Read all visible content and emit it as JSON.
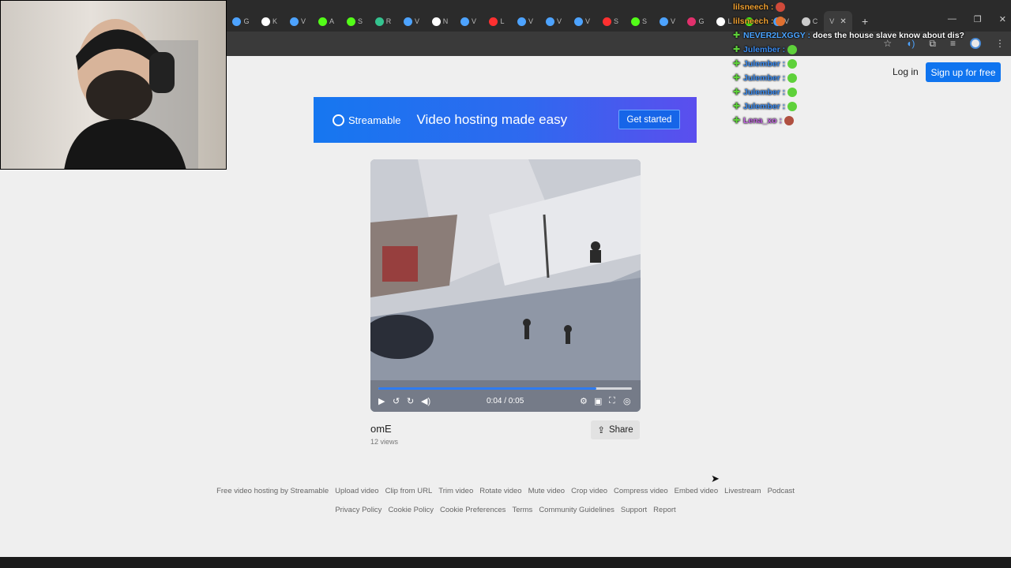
{
  "browser": {
    "tabs": [
      {
        "icon": "streamable-icon",
        "letter": "G",
        "color": "#4da3ff"
      },
      {
        "icon": "x-icon",
        "letter": "K",
        "color": "#ffffff"
      },
      {
        "icon": "streamable-icon",
        "letter": "V",
        "color": "#4da3ff"
      },
      {
        "icon": "kick-icon",
        "letter": "A",
        "color": "#53fc18"
      },
      {
        "icon": "kick-icon",
        "letter": "S",
        "color": "#53fc18"
      },
      {
        "icon": "sheets-icon",
        "letter": "R",
        "color": "#34c38f"
      },
      {
        "icon": "streamable-icon",
        "letter": "V",
        "color": "#4da3ff"
      },
      {
        "icon": "x-icon",
        "letter": "N",
        "color": "#ffffff"
      },
      {
        "icon": "streamable-icon",
        "letter": "V",
        "color": "#4da3ff"
      },
      {
        "icon": "youtube-icon",
        "letter": "L",
        "color": "#ff3030"
      },
      {
        "icon": "streamable-icon",
        "letter": "V",
        "color": "#4da3ff"
      },
      {
        "icon": "streamable-icon",
        "letter": "V",
        "color": "#4da3ff"
      },
      {
        "icon": "streamable-icon",
        "letter": "V",
        "color": "#4da3ff"
      },
      {
        "icon": "youtube-icon",
        "letter": "S",
        "color": "#ff3030"
      },
      {
        "icon": "kick-icon",
        "letter": "S",
        "color": "#53fc18"
      },
      {
        "icon": "streamable-icon",
        "letter": "V",
        "color": "#4da3ff"
      },
      {
        "icon": "instagram-icon",
        "letter": "G",
        "color": "#e1306c"
      },
      {
        "icon": "tiktok-icon",
        "letter": "L",
        "color": "#ffffff"
      },
      {
        "icon": "kick-icon",
        "letter": "H",
        "color": "#53fc18"
      },
      {
        "icon": "streamable-icon",
        "letter": "V",
        "color": "#4da3ff"
      },
      {
        "icon": "page-icon",
        "letter": "C",
        "color": "#cccccc"
      }
    ],
    "active_tab_letter": "V",
    "close_glyph": "✕",
    "new_tab_glyph": "+"
  },
  "chat": [
    {
      "user": "lilsneech",
      "user_color": "#f0a030",
      "msg": "",
      "badge": "",
      "emote_color": "#d04a3a"
    },
    {
      "user": "lilsneech",
      "user_color": "#f0a030",
      "msg": "",
      "badge": "",
      "emote_color": "#e07030"
    },
    {
      "user": "NEVER2LXGGY",
      "user_color": "#4aa3ff",
      "msg": "does the house slave know about dis?",
      "badge": "✚",
      "emote_color": ""
    },
    {
      "user": "Julember",
      "user_color": "#3a8bf0",
      "msg": "",
      "badge": "✚",
      "emote_color": "#5ed13a"
    },
    {
      "user": "Julember",
      "user_color": "#3a8bf0",
      "msg": "",
      "badge": "✚",
      "emote_color": "#5ed13a"
    },
    {
      "user": "Julember",
      "user_color": "#3a8bf0",
      "msg": "",
      "badge": "✚",
      "emote_color": "#5ed13a"
    },
    {
      "user": "Julember",
      "user_color": "#3a8bf0",
      "msg": "",
      "badge": "✚",
      "emote_color": "#5ed13a"
    },
    {
      "user": "Julember",
      "user_color": "#3a8bf0",
      "msg": "",
      "badge": "✚",
      "emote_color": "#5ed13a"
    },
    {
      "user": "Lena_xo",
      "user_color": "#c060e0",
      "msg": "",
      "badge": "✚",
      "emote_color": "#b05040"
    }
  ],
  "header": {
    "login": "Log in",
    "signup": "Sign up for free"
  },
  "banner": {
    "logo_text": "Streamable",
    "tagline": "Video hosting made easy",
    "cta": "Get started"
  },
  "video": {
    "timecode": "0:04 / 0:05",
    "progress": 0.86
  },
  "meta": {
    "title": "omE",
    "views": "12 views",
    "share": "Share"
  },
  "footer": {
    "row1": [
      "Free video hosting by Streamable",
      "Upload video",
      "Clip from URL",
      "Trim video",
      "Rotate video",
      "Mute video",
      "Crop video",
      "Compress video",
      "Embed video",
      "Livestream",
      "Podcast"
    ],
    "row2": [
      "Privacy Policy",
      "Cookie Policy",
      "Cookie Preferences",
      "Terms",
      "Community Guidelines",
      "Support",
      "Report"
    ]
  },
  "colors": {
    "accent": "#0f74ef",
    "progress": "#2f7bf0"
  }
}
